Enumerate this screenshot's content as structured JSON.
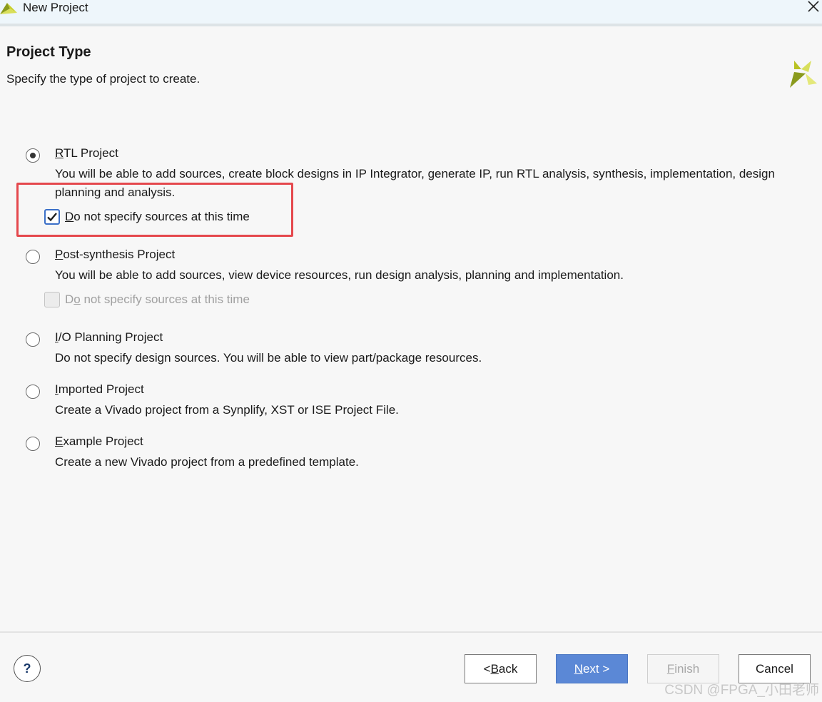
{
  "window": {
    "title": "New Project",
    "close_glyph": "✕"
  },
  "header": {
    "title": "Project Type",
    "subtitle": "Specify the type of project to create."
  },
  "options": [
    {
      "mnemonic": "R",
      "label_rest": "TL Project",
      "description": "You will be able to add sources, create block designs in IP Integrator, generate IP, run RTL analysis, synthesis, implementation, design planning and analysis.",
      "selected": true,
      "checkbox": {
        "mnemonic": "D",
        "label_rest": "o not specify sources at this time",
        "checked": true,
        "enabled": true
      }
    },
    {
      "mnemonic": "P",
      "label_rest": "ost-synthesis Project",
      "description": "You will be able to add sources, view device resources, run design analysis, planning and implementation.",
      "selected": false,
      "checkbox": {
        "label_pre": "D",
        "mnemonic": "o",
        "label_rest": " not specify sources at this time",
        "checked": false,
        "enabled": false
      }
    },
    {
      "mnemonic": "I",
      "label_rest": "/O Planning Project",
      "description": "Do not specify design sources. You will be able to view part/package resources.",
      "selected": false
    },
    {
      "mnemonic": "I",
      "label_rest": "mported Project",
      "description": "Create a Vivado project from a Synplify, XST or ISE Project File.",
      "selected": false
    },
    {
      "mnemonic": "E",
      "label_rest": "xample Project",
      "description": "Create a new Vivado project from a predefined template.",
      "selected": false
    }
  ],
  "footer": {
    "help_label": "?",
    "back": {
      "pre": "< ",
      "mnemonic": "B",
      "rest": "ack"
    },
    "next": {
      "mnemonic": "N",
      "rest": "ext >"
    },
    "finish": {
      "mnemonic": "F",
      "rest": "inish"
    },
    "cancel": {
      "label": "Cancel"
    }
  },
  "watermark": "CSDN @FPGA_小田老师",
  "colors": {
    "accent": "#5b88d6",
    "highlight": "#e5484d",
    "logo_yellow": "#c8cf2a",
    "logo_green": "#8a9a1c"
  },
  "icons": [
    "vivado-logo-icon",
    "close-icon",
    "xilinx-logo-icon",
    "checkmark-icon",
    "help-icon"
  ]
}
